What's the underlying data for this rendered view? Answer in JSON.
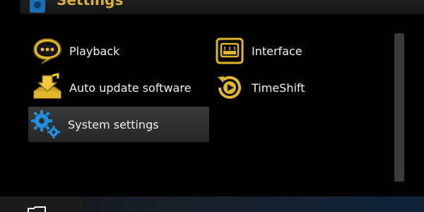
{
  "header": {
    "title": "Settings",
    "icon": "gear-icon"
  },
  "menu": {
    "items": [
      {
        "label": "Playback",
        "icon": "speech-bubble-icon"
      },
      {
        "label": "Interface",
        "icon": "tv-screen-icon"
      },
      {
        "label": "Auto update software",
        "icon": "download-box-icon"
      },
      {
        "label": "TimeShift",
        "icon": "timeshift-play-icon"
      },
      {
        "label": "System settings",
        "icon": "gears-icon",
        "selected": true
      }
    ]
  },
  "colors": {
    "accent_gold": "#e0b72b",
    "accent_blue": "#1e90e0",
    "selected_bg": "#2f2f2f"
  }
}
